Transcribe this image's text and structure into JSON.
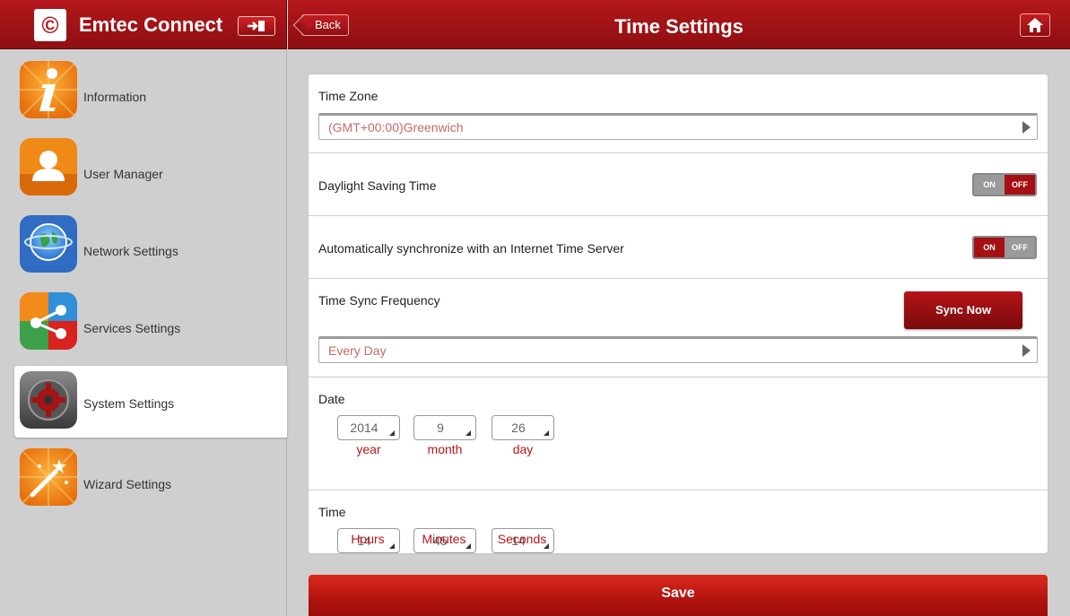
{
  "brand": {
    "name": "Emtec Connect",
    "logo_glyph": "©"
  },
  "header": {
    "back_label": "Back",
    "title": "Time Settings"
  },
  "sidebar": {
    "items": [
      {
        "label": "Information",
        "icon": "info-icon",
        "active": false
      },
      {
        "label": "User Manager",
        "icon": "user-icon",
        "active": false
      },
      {
        "label": "Network Settings",
        "icon": "globe-icon",
        "active": false
      },
      {
        "label": "Services Settings",
        "icon": "share-icon",
        "active": false
      },
      {
        "label": "System Settings",
        "icon": "gear-icon",
        "active": true
      },
      {
        "label": "Wizard Settings",
        "icon": "magic-wand-icon",
        "active": false
      }
    ]
  },
  "settings": {
    "time_zone": {
      "label": "Time Zone",
      "value": "(GMT+00:00)Greenwich"
    },
    "daylight_saving": {
      "label": "Daylight Saving Time",
      "on_label": "ON",
      "off_label": "OFF",
      "state": "off"
    },
    "auto_sync": {
      "label": "Automatically synchronize with an Internet Time Server",
      "on_label": "ON",
      "off_label": "OFF",
      "state": "on"
    },
    "sync_frequency": {
      "label": "Time Sync Frequency",
      "value": "Every Day",
      "sync_now_label": "Sync Now"
    },
    "date": {
      "label": "Date",
      "year": {
        "value": "2014",
        "caption": "year"
      },
      "month": {
        "value": "9",
        "caption": "month"
      },
      "day": {
        "value": "26",
        "caption": "day"
      }
    },
    "time": {
      "label": "Time",
      "hours": {
        "value": "14",
        "caption": "Hours"
      },
      "minutes": {
        "value": "45",
        "caption": "Minutes"
      },
      "seconds": {
        "value": "14",
        "caption": "Seconds"
      }
    }
  },
  "footer": {
    "save_label": "Save"
  },
  "colors": {
    "accent": "#b4171b",
    "dark_red": "#8e0f12",
    "value_text": "#c36a6a"
  }
}
